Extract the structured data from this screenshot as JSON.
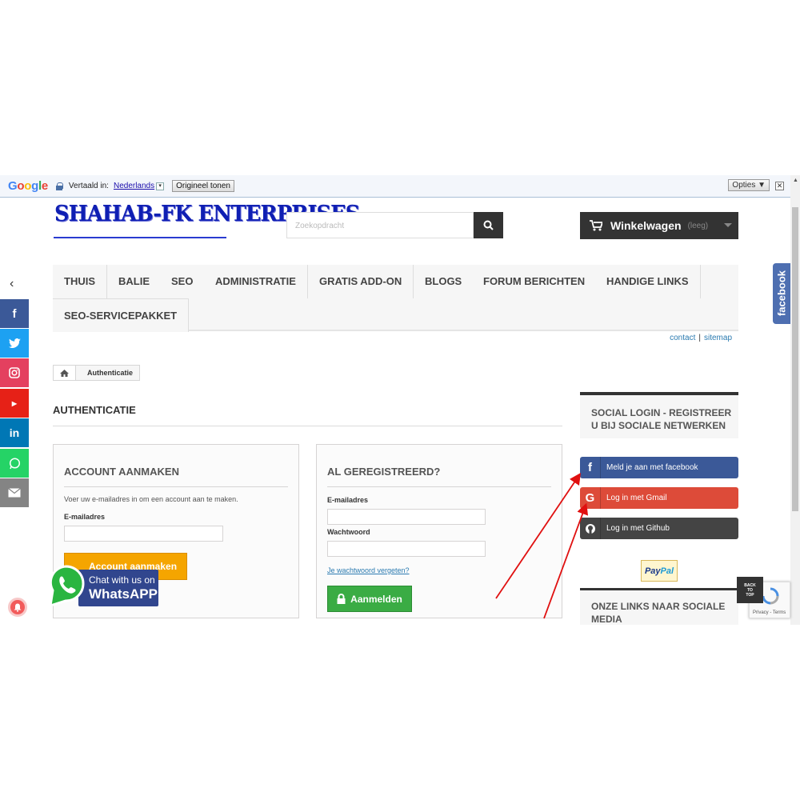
{
  "translate_bar": {
    "translated_in_label": "Vertaald in:",
    "language": "Nederlands",
    "show_original": "Origineel tonen",
    "options": "Opties ▼"
  },
  "header": {
    "logo_text": "SHAHAB-FK ENTERPRISES",
    "search_placeholder": "Zoekopdracht",
    "cart_label": "Winkelwagen",
    "cart_state": "(leeg)"
  },
  "menu": {
    "items": [
      "THUIS",
      "BALIE",
      "SEO",
      "ADMINISTRATIE",
      "GRATIS ADD-ON",
      "BLOGS",
      "FORUM BERICHTEN",
      "HANDIGE LINKS",
      "SEO-SERVICEPAKKET"
    ]
  },
  "top_links": {
    "contact": "contact",
    "separator": "|",
    "sitemap": "sitemap"
  },
  "breadcrumb": {
    "current": "Authenticatie"
  },
  "page_title": "AUTHENTICATIE",
  "create_account": {
    "title": "ACCOUNT AANMAKEN",
    "hint": "Voer uw e-mailadres in om een account aan te maken.",
    "email_label": "E-mailadres",
    "button": "Account aanmaken"
  },
  "login": {
    "title": "AL GEREGISTREERD?",
    "email_label": "E-mailadres",
    "password_label": "Wachtwoord",
    "forgot_link": "Je wachtwoord vergeten?",
    "button": "Aanmelden"
  },
  "sidebar": {
    "social_login_title": "SOCIAL LOGIN - REGISTREER U BIJ SOCIALE NETWERKEN",
    "facebook_button": "Meld je aan met facebook",
    "gmail_button": "Log in met Gmail",
    "github_button": "Log in met Github",
    "paypal_part1": "Pay",
    "paypal_part2": "Pal",
    "social_links_title": "ONZE LINKS NAAR SOCIALE MEDIA"
  },
  "widgets": {
    "facebook_tab": "facebook",
    "whatsapp_line1": "Chat with us on",
    "whatsapp_line2": "WhatsAPP",
    "back_to_top_1": "BACK",
    "back_to_top_2": "TO",
    "back_to_top_3": "TOP",
    "recaptcha_terms": "Privacy - Terms"
  },
  "share_bar": {
    "items": [
      {
        "icon": "facebook-icon",
        "color": "#3b5998"
      },
      {
        "icon": "twitter-icon",
        "color": "#1da1f2"
      },
      {
        "icon": "instagram-icon",
        "color": "#e4405f"
      },
      {
        "icon": "youtube-icon",
        "color": "#e62117"
      },
      {
        "icon": "linkedin-icon",
        "color": "#0077b5"
      },
      {
        "icon": "whatsapp-icon",
        "color": "#25d366"
      },
      {
        "icon": "email-icon",
        "color": "#848484"
      }
    ]
  },
  "colors": {
    "accent_dark": "#333333",
    "facebook": "#3b5998",
    "gmail": "#dd4b39",
    "github": "#444444",
    "orange_button": "#f5a500",
    "green_button": "#3aac44",
    "link": "#2a7ab0"
  }
}
